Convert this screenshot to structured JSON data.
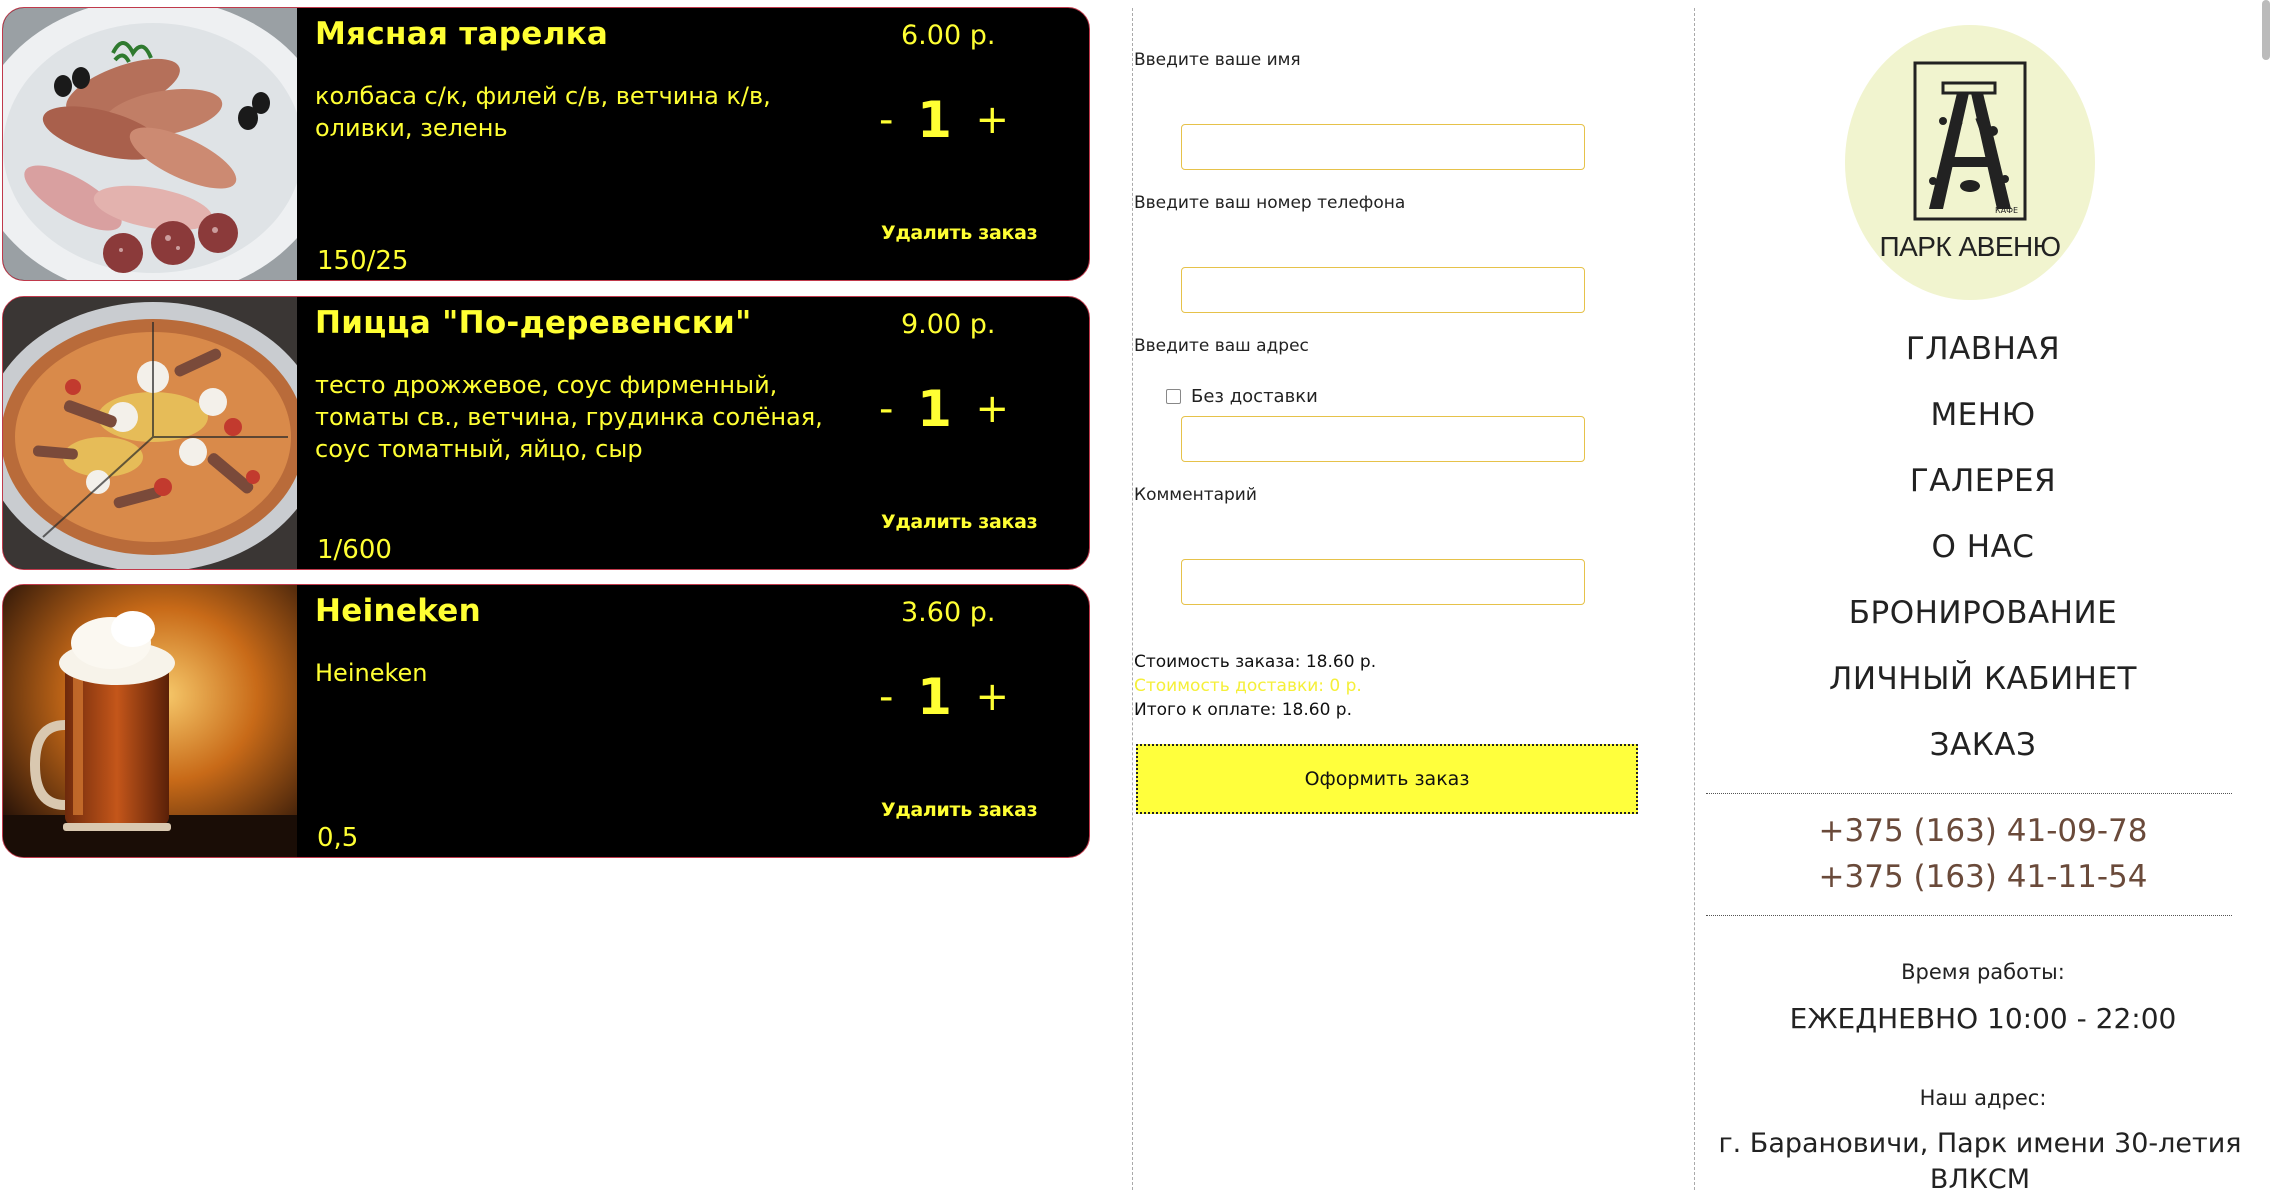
{
  "cart": {
    "items": [
      {
        "title": "Мясная тарелка",
        "description": "колбаса с/к, филей с/в, ветчина к/в, оливки, зелень",
        "weight": "150/25",
        "price": "6.00 р.",
        "quantity": "1",
        "minus": "-",
        "plus": "+",
        "remove": "Удалить заказ",
        "photo_icon": "meat-platter-photo"
      },
      {
        "title": "Пицца \"По-деревенски\"",
        "description": "тесто дрожжевое, соус фирменный, томаты св., ветчина, грудинка солёная, соус томатный, яйцо, сыр",
        "weight": "1/600",
        "price": "9.00 р.",
        "quantity": "1",
        "minus": "-",
        "plus": "+",
        "remove": "Удалить заказ",
        "photo_icon": "pizza-photo"
      },
      {
        "title": "Heineken",
        "description": "Heineken",
        "weight": "0,5",
        "price": "3.60 р.",
        "quantity": "1",
        "minus": "-",
        "plus": "+",
        "remove": "Удалить заказ",
        "photo_icon": "beer-mug-photo"
      }
    ]
  },
  "form": {
    "name_label": "Введите ваше имя",
    "name_value": "",
    "phone_label": "Введите ваш номер телефона",
    "phone_value": "",
    "address_label": "Введите ваш адрес",
    "no_delivery_label": "Без доставки",
    "address_value": "",
    "comment_label": "Комментарий",
    "comment_value": "",
    "order_cost": "Стоимость заказа: 18.60 р.",
    "delivery_cost": "Стоимость доставки: 0 р.",
    "total": "Итого к оплате: 18.60 р.",
    "submit_label": "Оформить заказ"
  },
  "sidebar": {
    "logo_small_text": "КАФЕ",
    "logo_text": "ПАРК АВЕНЮ",
    "nav": [
      "ГЛАВНАЯ",
      "МЕНЮ",
      "ГАЛЕРЕЯ",
      "О НАС",
      "БРОНИРОВАНИЕ",
      "ЛИЧНЫЙ КАБИНЕТ",
      "ЗАКАЗ"
    ],
    "phones": [
      "+375 (163) 41-09-78",
      "+375 (163) 41-11-54"
    ],
    "hours_label": "Время работы:",
    "hours": "ЕЖЕДНЕВНО 10:00 - 22:00",
    "address_label": "Наш адрес:",
    "address": "г. Барановичи, Парк имени 30-летия ВЛКСМ"
  },
  "colors": {
    "card_bg": "#000000",
    "card_text": "#ffff33",
    "card_border": "#c0394b",
    "submit_bg": "#ffff3c",
    "logo_bg": "#f1f4cf",
    "phone_text": "#6a4a3a"
  }
}
